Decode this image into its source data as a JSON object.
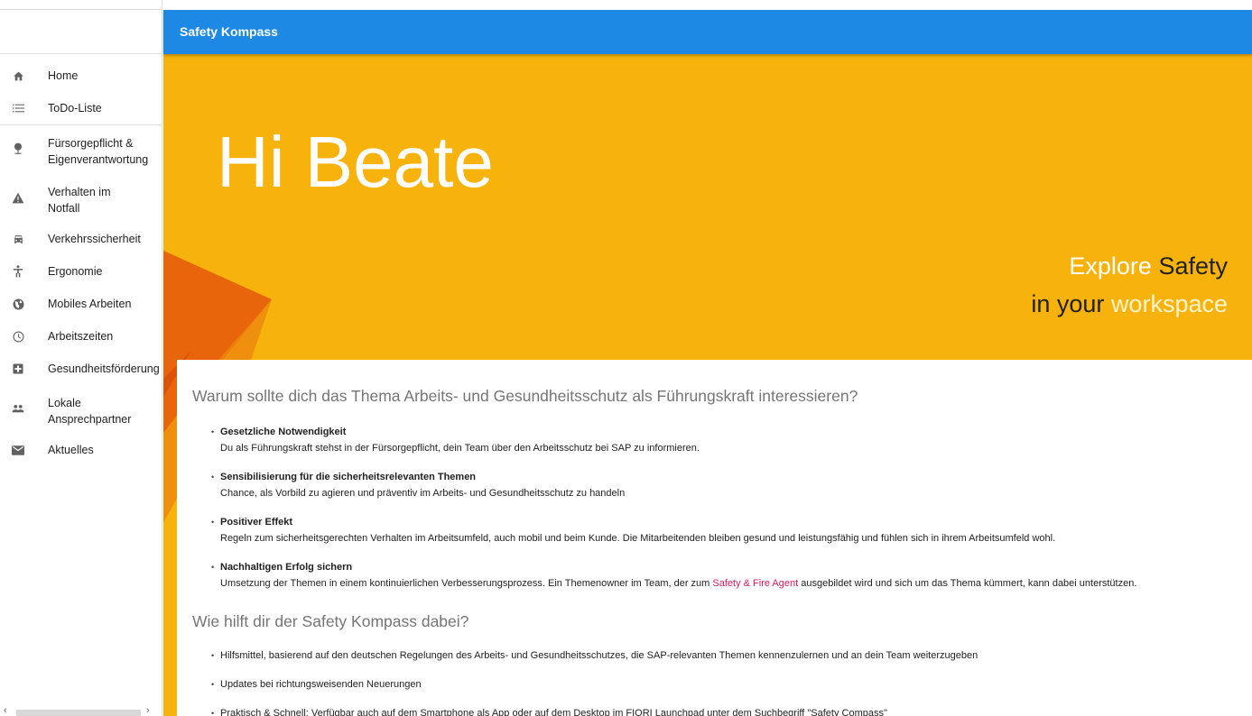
{
  "app": {
    "title": "Safety Kompass"
  },
  "sidebar": {
    "items": [
      {
        "label": "Home",
        "icon": "home-icon"
      },
      {
        "label": "ToDo-Liste",
        "icon": "list-icon"
      },
      {
        "label": "Fürsorgepflicht & Eigenverantwortung",
        "label_line1": "Fürsorgepflicht &",
        "label_line2": "Eigenverantwortung",
        "icon": "tree-icon"
      },
      {
        "label": "Verhalten im Notfall",
        "label_line1": "Verhalten im",
        "label_line2": "Notfall",
        "icon": "warning-icon"
      },
      {
        "label": "Verkehrssicherheit",
        "icon": "car-icon"
      },
      {
        "label": "Ergonomie",
        "icon": "accessibility-icon"
      },
      {
        "label": "Mobiles Arbeiten",
        "icon": "globe-icon"
      },
      {
        "label": "Arbeitszeiten",
        "icon": "clock-icon"
      },
      {
        "label": "Gesundheitsförderung",
        "icon": "medical-plus-icon"
      },
      {
        "label": "Lokale Ansprechpartner",
        "label_line1": "Lokale",
        "label_line2": "Ansprechpartner",
        "icon": "people-icon"
      },
      {
        "label": "Aktuelles",
        "icon": "mail-icon"
      }
    ]
  },
  "hero": {
    "greeting": "Hi Beate",
    "tagline": {
      "word1": "Explore",
      "word2": "Safety",
      "word3": "in your",
      "word4": "workspace"
    }
  },
  "content": {
    "heading1": "Warum sollte dich das Thema Arbeits- und Gesundheitsschutz als Führungskraft interessieren?",
    "reasons": [
      {
        "title": "Gesetzliche Notwendigkeit",
        "text": "Du als Führungskraft stehst in der Fürsorgepflicht, dein Team über den Arbeitsschutz bei SAP zu informieren."
      },
      {
        "title": "Sensibilisierung für die sicherheitsrelevanten Themen",
        "text": "Chance, als Vorbild zu agieren und präventiv im Arbeits- und Gesundheitsschutz zu handeln"
      },
      {
        "title": "Positiver Effekt",
        "text": "Regeln zum sicherheitsgerechten Verhalten im Arbeitsumfeld, auch mobil und beim Kunde. Die Mitarbeitenden bleiben gesund und leistungsfähig und fühlen sich in ihrem Arbeitsumfeld wohl."
      },
      {
        "title": "Nachhaltigen Erfolg sichern",
        "text_before": "Umsetzung der Themen in einem kontinuierlichen Verbesserungsprozess. Ein Themenowner im Team, der zum ",
        "link": "Safety & Fire Agent",
        "text_after": " ausgebildet wird und sich um das Thema kümmert, kann dabei unterstützen."
      }
    ],
    "heading2": "Wie hilft dir der Safety Kompass dabei?",
    "benefits": [
      "Hilfsmittel, basierend auf den deutschen Regelungen des Arbeits- und Gesundheitsschutzes, die SAP-relevanten Themen kennenzulernen und an dein Team weiterzugeben",
      "Updates bei richtungsweisenden Neuerungen",
      "Praktisch & Schnell: Verfügbar auch auf dem Smartphone als App oder auf dem Desktop im FIORI Launchpad unter dem Suchbegriff \"Safety Compass\""
    ]
  },
  "colors": {
    "topbar": "#1e88e5",
    "hero": "#f7b20c",
    "hero_shape_dark": "#e8650b",
    "hero_shape_mid": "#ef8a0c",
    "link": "#d81b60"
  },
  "scrollbar": {
    "left_arrow": "‹",
    "right_arrow": "›"
  }
}
